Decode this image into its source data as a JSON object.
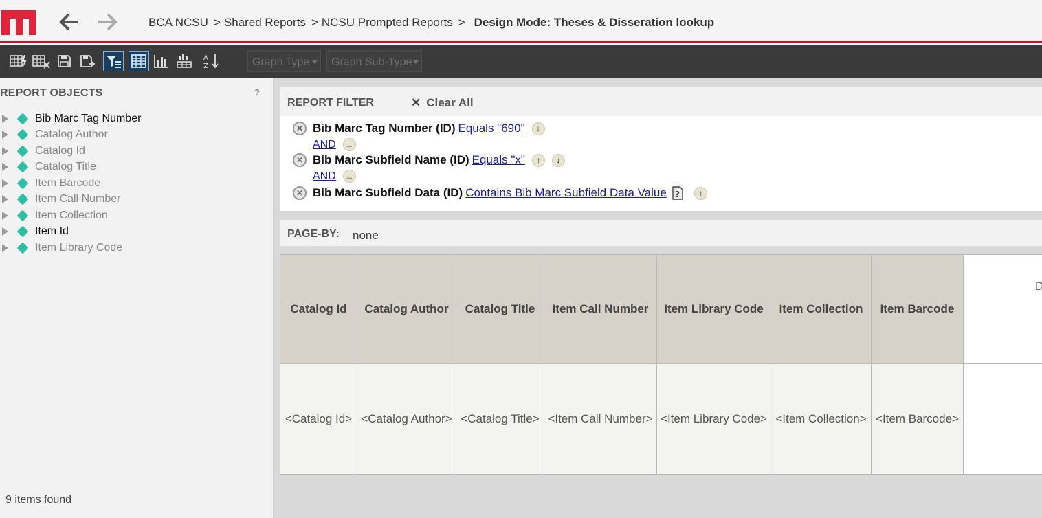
{
  "header": {
    "breadcrumb": [
      {
        "label": "BCA NCSU"
      },
      {
        "label": "Shared Reports"
      },
      {
        "label": "NCSU Prompted Reports"
      }
    ],
    "separator": ">",
    "current": "Design Mode: Theses & Disseration lookup"
  },
  "toolbar": {
    "graph_type": "Graph Type",
    "graph_sub_type": "Graph Sub-Type"
  },
  "left_panel": {
    "title": "REPORT OBJECTS",
    "help": "?",
    "items": [
      {
        "label": "Bib Marc Tag Number"
      },
      {
        "label": "Catalog Author"
      },
      {
        "label": "Catalog Id"
      },
      {
        "label": "Catalog Title"
      },
      {
        "label": "Item Barcode"
      },
      {
        "label": "Item Call Number"
      },
      {
        "label": "Item Collection"
      },
      {
        "label": "Item Id"
      },
      {
        "label": "Item Library Code"
      }
    ],
    "items_found": "9 items found"
  },
  "filter": {
    "title": "REPORT FILTER",
    "clear_all": "Clear All",
    "conditions": [
      {
        "field": "Bib Marc Tag Number (ID)",
        "op": "Equals \"690\""
      },
      {
        "field": "Bib Marc Subfield Name (ID)",
        "op": "Equals \"x\""
      },
      {
        "field": "Bib Marc Subfield Data (ID)",
        "op": "Contains Bib Marc Subfield Data Value"
      }
    ],
    "and_1": "AND",
    "and_2": "AND"
  },
  "page_by": {
    "label": "PAGE-BY:",
    "value": "none"
  },
  "grid": {
    "columns": [
      {
        "header": "Catalog Id",
        "value": "<Catalog Id>"
      },
      {
        "header": "Catalog Author",
        "value": "<Catalog Author>"
      },
      {
        "header": "Catalog Title",
        "value": "<Catalog Title>"
      },
      {
        "header": "Item Call Number",
        "value": "<Item Call Number>"
      },
      {
        "header": "Item Library Code",
        "value": "<Item Library Code>"
      },
      {
        "header": "Item Collection",
        "value": "<Item Collection>"
      },
      {
        "header": "Item Barcode",
        "value": "<Item Barcode>"
      }
    ],
    "partial_header": "D"
  },
  "colors": {
    "brand_red": "#c8102e",
    "toolbar_bg": "#3a3a3a",
    "diamond": "#2bbfa4",
    "header_cell": "#d6d2ca",
    "link": "#1a1a9a"
  },
  "icons": [
    "logo",
    "back-arrow-icon",
    "forward-arrow-icon",
    "report-run-icon",
    "report-close-icon",
    "save-icon",
    "save-as-icon",
    "filter-icon",
    "grid-view-icon",
    "graph-view-icon",
    "grid-graph-icon",
    "sort-icon",
    "expand-icon",
    "attribute-icon",
    "remove-icon",
    "arrow-right-icon",
    "arrow-up-icon",
    "arrow-down-icon",
    "prompt-icon"
  ]
}
